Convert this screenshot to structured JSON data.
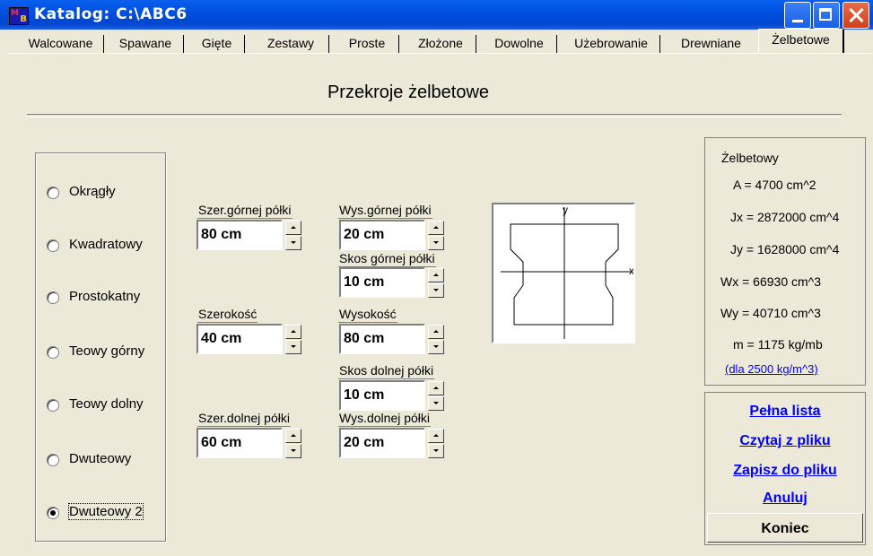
{
  "window": {
    "title": "Katalog: C:\\ABC6",
    "icon_text_left": "M",
    "icon_text_right": "B"
  },
  "tabs": [
    {
      "label": "Walcowane",
      "active": false
    },
    {
      "label": "Spawane",
      "active": false
    },
    {
      "label": "Gięte",
      "active": false
    },
    {
      "label": "Zestawy",
      "active": false
    },
    {
      "label": "Proste",
      "active": false
    },
    {
      "label": "Złożone",
      "active": false
    },
    {
      "label": "Dowolne",
      "active": false
    },
    {
      "label": "Użebrowanie",
      "active": false
    },
    {
      "label": "Drewniane",
      "active": false
    },
    {
      "label": "Żelbetowe",
      "active": true
    }
  ],
  "heading": "Przekroje żelbetowe",
  "section_types": [
    {
      "label": "Okrągły",
      "selected": false
    },
    {
      "label": "Kwadratowy",
      "selected": false
    },
    {
      "label": "Prostokatny",
      "selected": false
    },
    {
      "label": "Teowy górny",
      "selected": false
    },
    {
      "label": "Teowy dolny",
      "selected": false
    },
    {
      "label": "Dwuteowy",
      "selected": false
    },
    {
      "label": "Dwuteowy 2",
      "selected": true
    }
  ],
  "fields": {
    "top_flange_width": {
      "label": "Szer.górnej półki",
      "value": "80 cm"
    },
    "top_flange_height": {
      "label": "Wys.górnej półki",
      "value": "20 cm"
    },
    "top_flange_bevel": {
      "label": "Skos górnej półki",
      "value": "10 cm"
    },
    "width": {
      "label": "Szerokość",
      "value": "40 cm"
    },
    "height": {
      "label": "Wysokość",
      "value": "80 cm"
    },
    "bottom_flange_bevel": {
      "label": "Skos dolnej półki",
      "value": "10 cm"
    },
    "bottom_flange_width": {
      "label": "Szer.dolnej półki",
      "value": "60 cm"
    },
    "bottom_flange_height": {
      "label": "Wys.dolnej półki",
      "value": "20 cm"
    }
  },
  "diagram": {
    "axis_x": "x",
    "axis_y": "y"
  },
  "properties": {
    "title": "Żelbetowy",
    "A": "A = 4700 cm^2",
    "Jx": "Jx = 2872000 cm^4",
    "Jy": "Jy = 1628000 cm^4",
    "Wx": "Wx = 66930 cm^3",
    "Wy": "Wy = 40710 cm^3",
    "m": "m = 1175 kg/mb",
    "density_link": "(dla 2500 kg/m^3)"
  },
  "actions": {
    "full_list": "Pełna lista",
    "read_file": "Czytaj z pliku",
    "save_file": "Zapisz do pliku",
    "cancel": "Anuluj",
    "finish": "Koniec"
  },
  "colors": {
    "titlebar": "#0050e0",
    "link": "#0000ff",
    "face": "#ece9d8"
  }
}
